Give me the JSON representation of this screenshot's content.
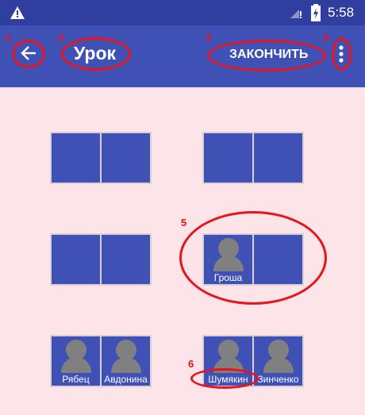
{
  "status_bar": {
    "time": "5:58",
    "icons": [
      "warning-icon",
      "signal-icon",
      "battery-charging-icon"
    ]
  },
  "toolbar": {
    "back_icon": "arrow-left-icon",
    "title": "Урок",
    "finish_label": "ЗАКОНЧИТЬ",
    "menu_icon": "more-vert-icon"
  },
  "desks": [
    {
      "seats": [
        {
          "name": null
        },
        {
          "name": null
        }
      ]
    },
    {
      "seats": [
        {
          "name": null
        },
        {
          "name": null
        }
      ]
    },
    {
      "seats": [
        {
          "name": null
        },
        {
          "name": null
        }
      ]
    },
    {
      "seats": [
        {
          "name": "Гроша"
        },
        {
          "name": null
        }
      ]
    },
    {
      "seats": [
        {
          "name": "Рябец"
        },
        {
          "name": "Авдонина"
        }
      ]
    },
    {
      "seats": [
        {
          "name": "Шумякин"
        },
        {
          "name": "Зинченко"
        }
      ]
    }
  ],
  "annotations": [
    "1",
    "2",
    "3",
    "4",
    "5",
    "6"
  ],
  "colors": {
    "primary": "#3f51b5",
    "primary_dark": "#303f9f",
    "background": "#fce4e8",
    "annotation": "#e8141c",
    "avatar": "#808080"
  }
}
